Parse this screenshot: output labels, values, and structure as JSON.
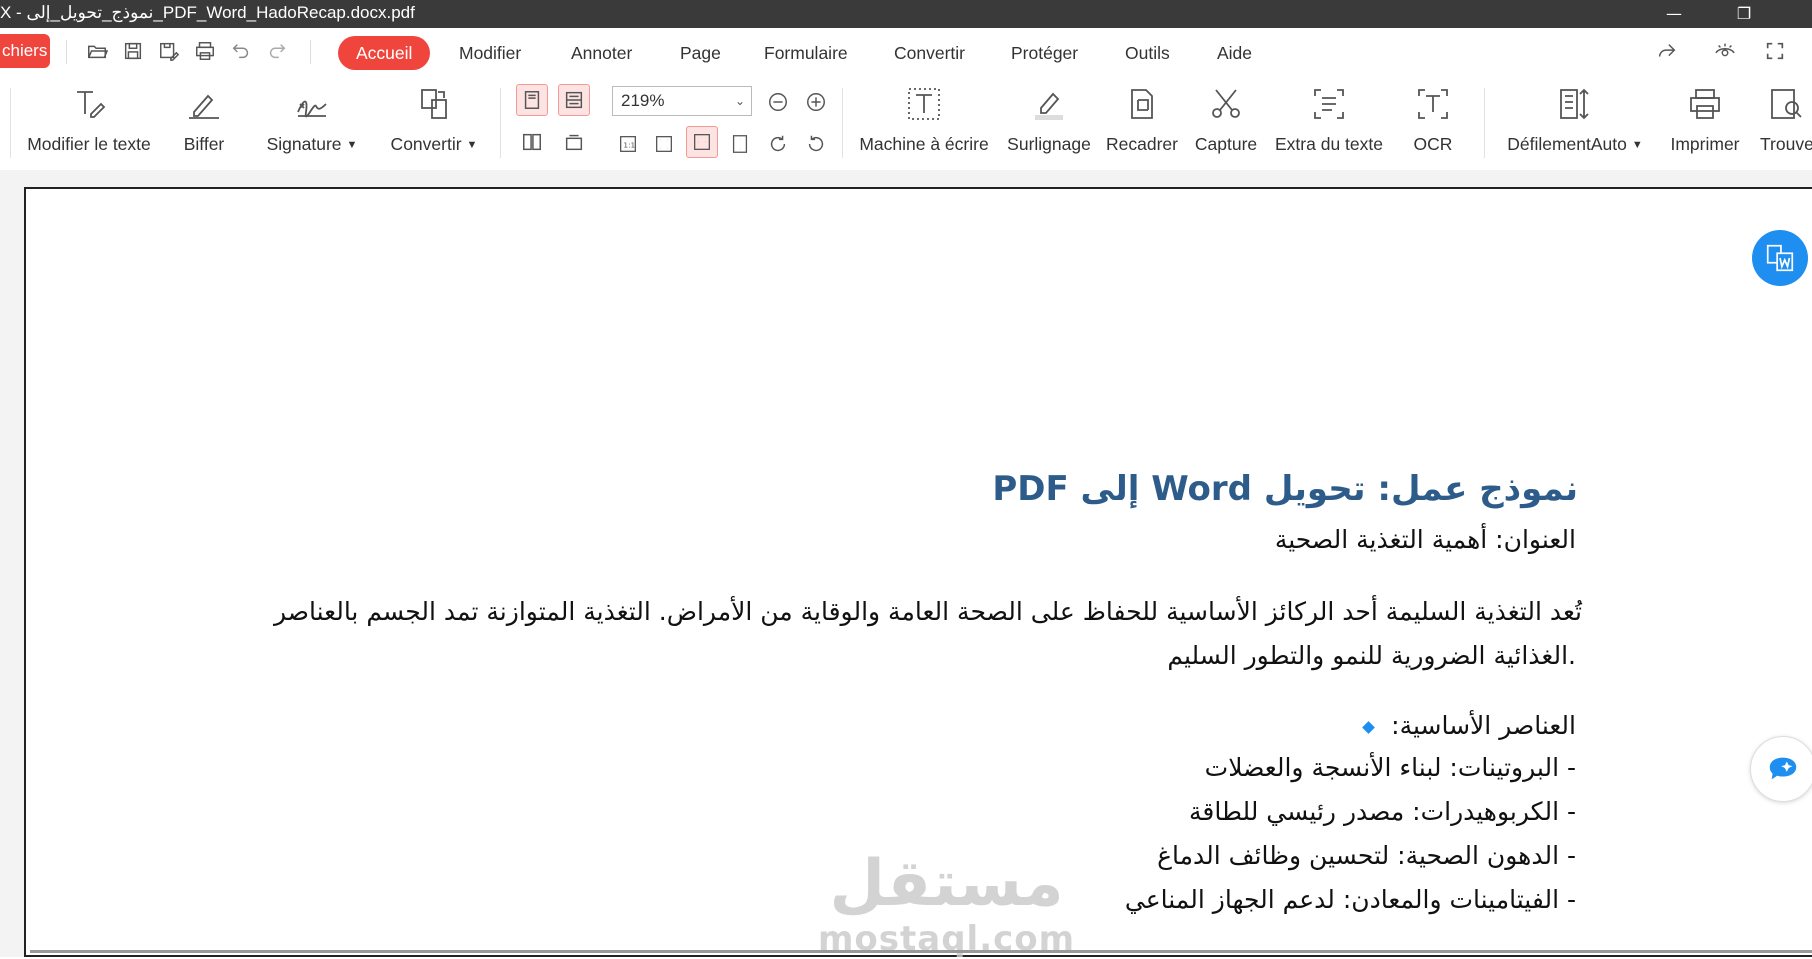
{
  "window": {
    "title": "X - نموذج_تحويل_إلى_PDF_Word_HadoRecap.docx.pdf",
    "controls": [
      "minimize",
      "restore"
    ]
  },
  "menubar": {
    "file_button": "chiers",
    "quick_access_icons": [
      "open-folder-icon",
      "save-icon",
      "save-as-icon",
      "print-icon",
      "undo-icon",
      "redo-icon"
    ],
    "items": [
      "Accueil",
      "Modifier",
      "Annoter",
      "Page",
      "Formulaire",
      "Convertir",
      "Protéger",
      "Outils",
      "Aide"
    ],
    "active_item": "Accueil",
    "right_icons": [
      "share-icon",
      "eye-icon",
      "fullscreen-icon"
    ]
  },
  "ribbon": {
    "tools_left": [
      {
        "label": "Modifier le texte",
        "icon": "edit-text-icon",
        "dropdown": false
      },
      {
        "label": "Biffer",
        "icon": "strikeout-icon",
        "dropdown": false
      },
      {
        "label": "Signature",
        "icon": "signature-icon",
        "dropdown": true
      },
      {
        "label": "Convertir",
        "icon": "convert-icon",
        "dropdown": true
      }
    ],
    "zoom": "219%",
    "tools_right": [
      {
        "label": "Machine à écrire",
        "icon": "typewriter-icon",
        "dropdown": false
      },
      {
        "label": "Surlignage",
        "icon": "highlighter-icon",
        "dropdown": false
      },
      {
        "label": "Recadrer",
        "icon": "crop-icon",
        "dropdown": false
      },
      {
        "label": "Capture",
        "icon": "scissors-icon",
        "dropdown": false
      },
      {
        "label": "Extra du texte",
        "icon": "extract-text-icon",
        "dropdown": false
      },
      {
        "label": "OCR",
        "icon": "ocr-icon",
        "dropdown": false
      },
      {
        "label": "DéfilementAuto",
        "icon": "autoscroll-icon",
        "dropdown": true
      },
      {
        "label": "Imprimer",
        "icon": "printer-icon",
        "dropdown": false
      },
      {
        "label": "Trouve",
        "icon": "find-icon",
        "dropdown": false
      }
    ]
  },
  "document": {
    "heading": "نموذج عمل: تحويل Word إلى PDF",
    "subtitle": "العنوان: أهمية التغذية الصحية",
    "paragraph_line1": "تُعد التغذية السليمة أحد الركائز الأساسية للحفاظ على الصحة العامة والوقاية من الأمراض. التغذية المتوازنة تمد الجسم بالعناصر",
    "paragraph_line2": ".الغذائية الضرورية للنمو والتطور السليم",
    "list_title": "العناصر الأساسية:",
    "list_items": [
      "- البروتينات: لبناء الأنسجة والعضلات",
      "- الكربوهيدرات: مصدر رئيسي للطاقة",
      "- الدهون الصحية: لتحسين وظائف الدماغ",
      "- الفيتامينات والمعادن: لدعم الجهاز المناعي"
    ]
  },
  "watermark": {
    "arabic": "مستقل",
    "latin": "mostaql.com"
  },
  "colors": {
    "accent": "#f0453d",
    "heading": "#2e5c8a",
    "fab_blue": "#1f8ef1"
  }
}
